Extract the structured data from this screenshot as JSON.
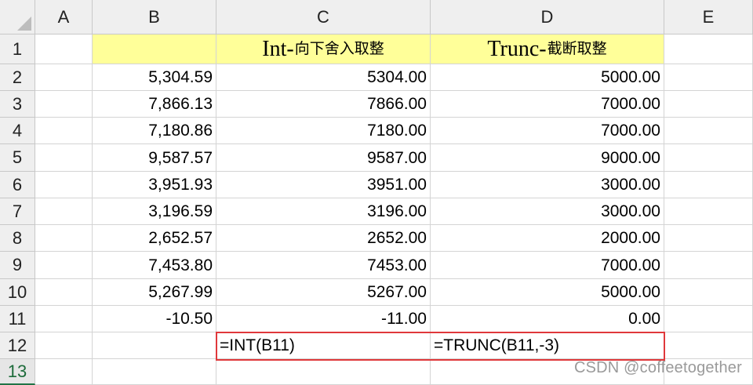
{
  "columns": [
    "A",
    "B",
    "C",
    "D",
    "E"
  ],
  "rows": [
    "1",
    "2",
    "3",
    "4",
    "5",
    "6",
    "7",
    "8",
    "9",
    "10",
    "11",
    "12",
    "13"
  ],
  "headers": {
    "c_main": "Int-",
    "c_sub": "向下舍入取整",
    "d_main": "Trunc-",
    "d_sub": "截断取整"
  },
  "data": [
    {
      "b": "5,304.59",
      "c": "5304.00",
      "d": "5000.00"
    },
    {
      "b": "7,866.13",
      "c": "7866.00",
      "d": "7000.00"
    },
    {
      "b": "7,180.86",
      "c": "7180.00",
      "d": "7000.00"
    },
    {
      "b": "9,587.57",
      "c": "9587.00",
      "d": "9000.00"
    },
    {
      "b": "3,951.93",
      "c": "3951.00",
      "d": "3000.00"
    },
    {
      "b": "3,196.59",
      "c": "3196.00",
      "d": "3000.00"
    },
    {
      "b": "2,652.57",
      "c": "2652.00",
      "d": "2000.00"
    },
    {
      "b": "7,453.80",
      "c": "7453.00",
      "d": "7000.00"
    },
    {
      "b": "5,267.99",
      "c": "5267.00",
      "d": "5000.00"
    },
    {
      "b": "-10.50",
      "c": "-11.00",
      "d": "0.00"
    }
  ],
  "formulas": {
    "c12": "=INT(B11)",
    "d12": "=TRUNC(B11,-3)"
  },
  "watermark": "CSDN @coffeetogether",
  "colors": {
    "header_fill": "#ffff99",
    "formula_border": "#e0383b",
    "selected_row": "#217346"
  }
}
